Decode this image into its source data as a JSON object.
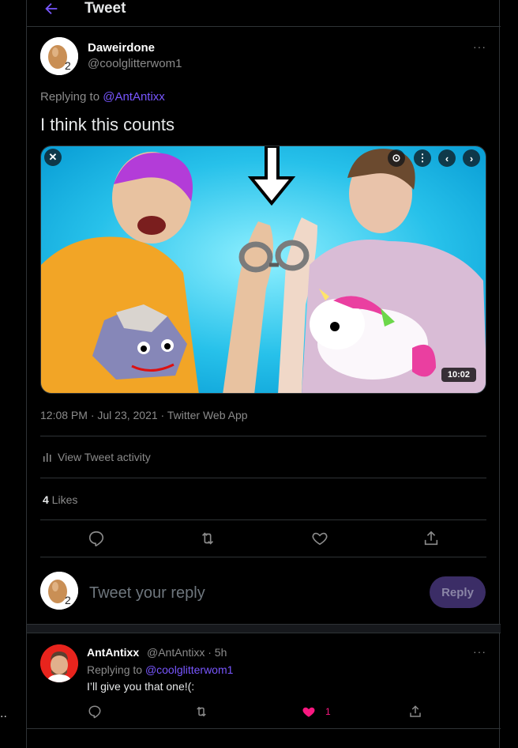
{
  "header": {
    "title": "Tweet"
  },
  "tweet": {
    "author_name": "Daweirdone",
    "author_handle": "@coolglitterwom1",
    "more": "···",
    "replying_prefix": "Replying to ",
    "replying_to": "@AntAntixx",
    "text": "I think this counts",
    "video_duration": "10:02",
    "meta": "12:08 PM · Jul 23, 2021 · Twitter Web App",
    "activity_label": "View Tweet activity",
    "likes_count": "4",
    "likes_label": " Likes"
  },
  "composer": {
    "placeholder": "Tweet your reply",
    "reply_button": "Reply"
  },
  "reply": {
    "author_name": "AntAntixx",
    "author_handle": "@AntAntixx",
    "time": " · 5h",
    "more": "···",
    "replying_prefix": "Replying to ",
    "replying_to": "@coolglitterwom1",
    "text": "I’ll give you that one!(:",
    "like_count": "1"
  },
  "stray": {
    "dots": ".."
  },
  "colors": {
    "accent": "#7856ff",
    "like": "#f91880",
    "video_bg": "#27c1ea"
  },
  "icons": [
    "back-arrow-icon",
    "more-icon",
    "close-icon",
    "scan-icon",
    "chevron-left-icon",
    "chevron-right-icon",
    "activity-icon",
    "reply-icon",
    "retweet-icon",
    "like-icon",
    "share-icon",
    "heart-filled-icon"
  ]
}
